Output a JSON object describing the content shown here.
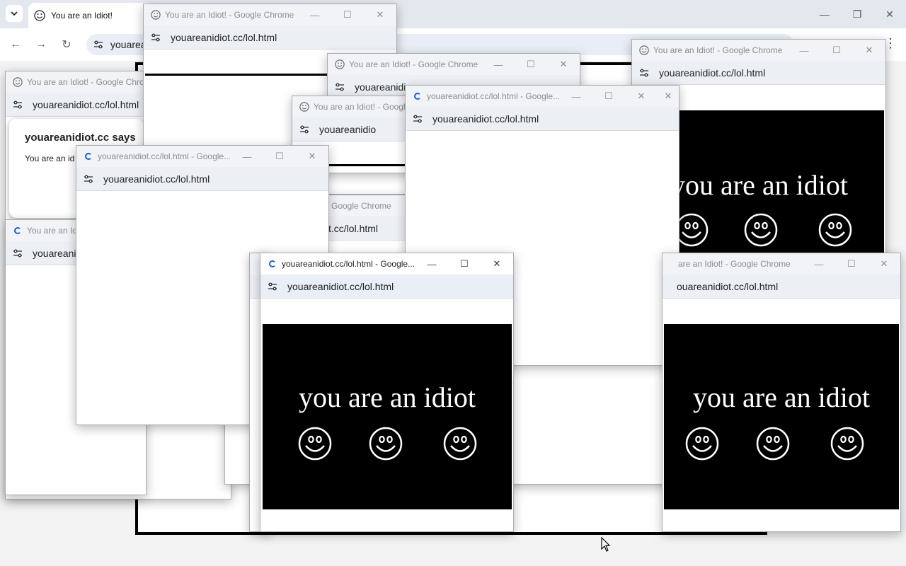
{
  "main_browser": {
    "tab_title": "You are an Idiot!",
    "address_partial": "youarea",
    "menu_icon": "chevron-down-icon",
    "controls": [
      "minimize-icon",
      "restore-icon",
      "close-icon"
    ]
  },
  "popup": {
    "title_idiot": "You are an Idiot! - Google Chrome",
    "title_idiot_short": "You are an Idiot! - Google Chrom",
    "title_idiot_short2": "You are an Idiot! - Google",
    "title_loading": "youareanidiot.cc/lol.html - Google...",
    "title_loading_partial": "You are an Idio",
    "title_partial_right": "are an Idiot! - Google Chrome",
    "title_google_chrome": "Google Chrome",
    "url": "youareanidiot.cc/lol.html",
    "url_cut1": "youareanidiot.cc/lol.html",
    "url_cut2": "youareanidio",
    "url_cut3": "youareani",
    "url_cut4": "t.cc/lol.html",
    "url_cut5": "youareanidiot.cc/lol.html",
    "url_cut6": "ouareanidiot.cc/lol.html",
    "page_text": "you are an idiot"
  },
  "dialog": {
    "title": "youareanidiot.cc says",
    "message": "You are an id"
  },
  "colors": {
    "titlebar": "#f1f3f6",
    "addressbar": "#e9eef7",
    "page_black": "#000000",
    "page_text": "#ffffff",
    "accent_spinner": "#1a5fd6"
  }
}
